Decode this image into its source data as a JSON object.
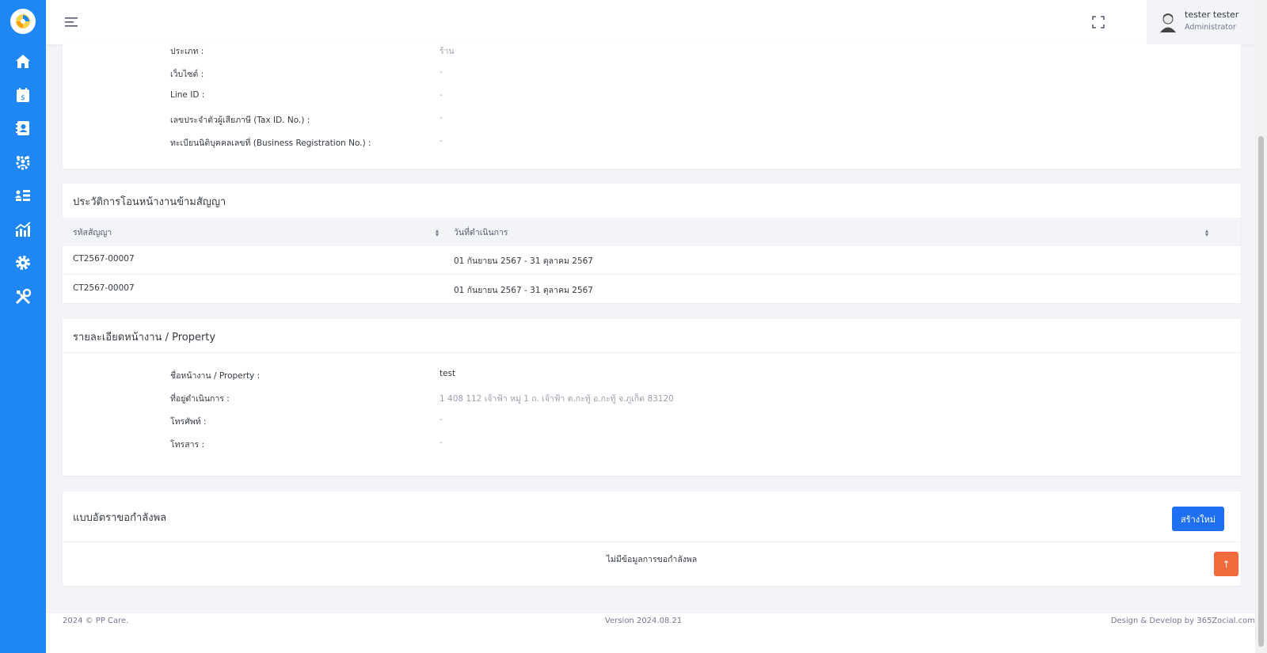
{
  "user": {
    "name": "tester tester",
    "role": "Administrator"
  },
  "company_info": {
    "rows": [
      {
        "label": "ประเภท :",
        "value": "ร้าน"
      },
      {
        "label": "เว็บไซต์ :",
        "value": "-"
      },
      {
        "label": "Line ID :",
        "value": "-"
      },
      {
        "label": "เลขประจำตัวผู้เสียภาษี (Tax ID. No.) :",
        "value": "-"
      },
      {
        "label": "ทะเบียนนิติบุคคลเลขที่ (Business Registration No.) :",
        "value": "-"
      }
    ]
  },
  "transfer_history": {
    "title": "ประวัติการโอนหน้างานข้ามสัญญา",
    "columns": [
      "รหัสสัญญา",
      "วันที่ดำเนินการ"
    ],
    "rows": [
      [
        "CT2567-00007",
        "01 กันยายน 2567 - 31 ตุลาคม 2567"
      ],
      [
        "CT2567-00007",
        "01 กันยายน 2567 - 31 ตุลาคม 2567"
      ]
    ]
  },
  "property": {
    "title": "รายละเอียดหน้างาน / Property",
    "rows": [
      {
        "label": "ชื่อหน้างาน / Property :",
        "value": "test"
      },
      {
        "label": "ที่อยู่ดำเนินการ :",
        "value": "1 408 112 เจ้าฟ้า หมู่ 1 ถ. เจ้าฟ้า ต.กะทู้ อ.กะทู้ จ.ภูเก็ต 83120"
      },
      {
        "label": "โทรศัพท์ :",
        "value": "-"
      },
      {
        "label": "โทรสาร :",
        "value": "-"
      }
    ]
  },
  "manpower": {
    "title": "แบบอัตราขอกำลังพล",
    "new_button": "สร้างใหม่",
    "empty_text": "ไม่มีข้อมูลการขอกำลังพล"
  },
  "footer": {
    "copyright": "2024 © PP Care.",
    "version": "Version 2024.08.21",
    "credit": "Design & Develop by 365Zocial.com"
  },
  "colors": {
    "sidebar": "#1e86f5",
    "primary_button": "#1e6ff2",
    "back_to_top": "#f26b3d"
  },
  "icons": {
    "sidebar": [
      "home-icon",
      "billing-calendar-icon",
      "contacts-icon",
      "team-settings-icon",
      "staff-list-icon",
      "analytics-icon",
      "settings-gear-icon",
      "tools-icon"
    ],
    "topbar": [
      "hamburger-menu-icon",
      "fullscreen-icon",
      "user-avatar"
    ]
  }
}
